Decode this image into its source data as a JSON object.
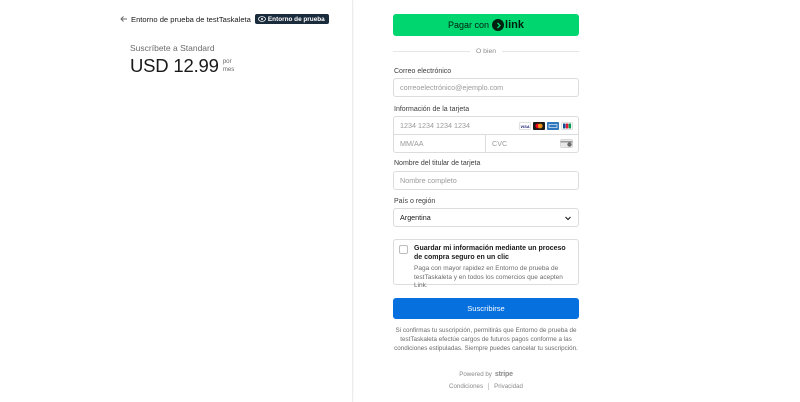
{
  "summary": {
    "merchant_name": "Entorno de prueba de testTaskaleta",
    "sandbox_badge": "Entorno de prueba",
    "subscribe_label": "Suscríbete a Standard",
    "price": "USD 12.99",
    "per_line1": "por",
    "per_line2": "mes"
  },
  "link_button": {
    "label": "Pagar con",
    "logo_text": "link"
  },
  "divider": {
    "text": "O bien"
  },
  "email": {
    "label": "Correo electrónico",
    "placeholder": "correoelectrónico@ejemplo.com"
  },
  "card": {
    "label": "Información de la tarjeta",
    "number_placeholder": "1234 1234 1234 1234",
    "expiry_placeholder": "MM/AA",
    "cvc_placeholder": "CVC",
    "brands": [
      "visa-icon",
      "mastercard-icon",
      "amex-icon",
      "jcb-icon"
    ],
    "visa_text": "VISA"
  },
  "cardholder": {
    "label": "Nombre del titular de tarjeta",
    "placeholder": "Nombre completo"
  },
  "country": {
    "label": "País o región",
    "value": "Argentina"
  },
  "save_info": {
    "title": "Guardar mi información mediante un proceso de compra seguro en un clic",
    "description": "Paga con mayor rapidez en Entorno de prueba de testTaskaleta y en todos los comercios que acepten Link."
  },
  "subscribe_button": {
    "label": "Suscribirse"
  },
  "legal": {
    "text": "Si confirmas tu suscripción, permitirás que Entorno de prueba de testTaskaleta efectúe cargos de futuros pagos conforme a las condiciones estipuladas. Siempre puedes cancelar tu suscripción."
  },
  "footer": {
    "powered_by": "Powered by",
    "stripe": "stripe",
    "terms": "Condiciones",
    "privacy": "Privacidad"
  },
  "colors": {
    "link_green": "#00d66f",
    "primary_blue": "#0570de",
    "badge_navy": "#1a2b3c"
  }
}
